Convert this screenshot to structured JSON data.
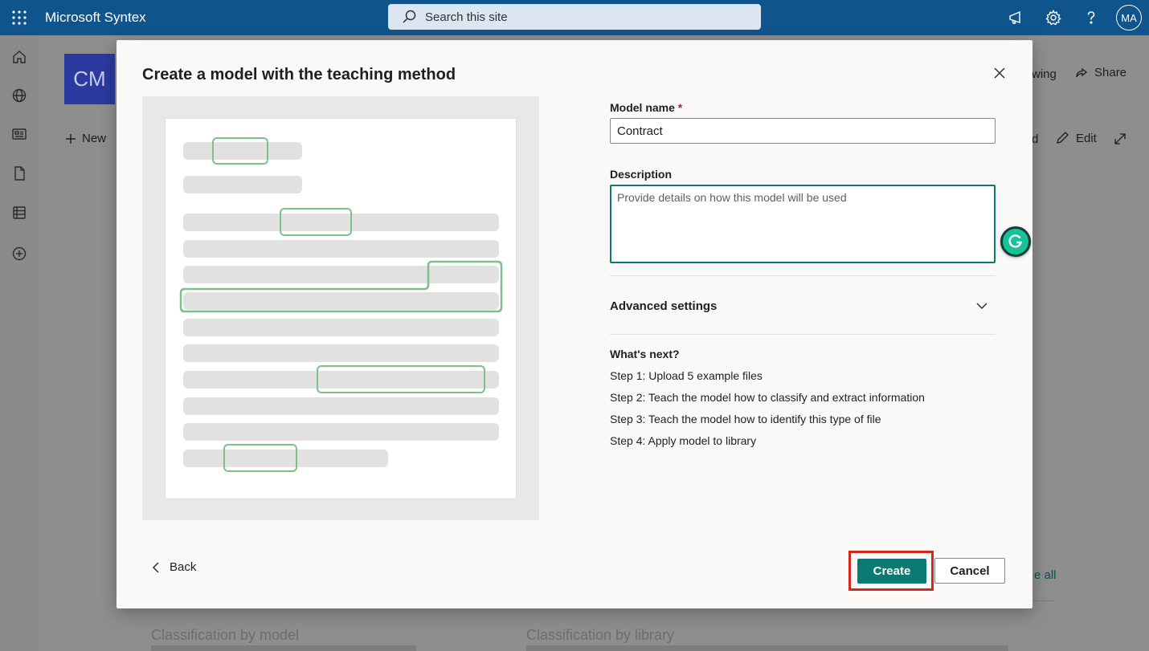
{
  "suitebar": {
    "app_name": "Microsoft Syntex",
    "search_placeholder": "Search this site",
    "avatar_initials": "MA",
    "brand_color": "#0f548c"
  },
  "rail": {
    "icons": [
      "home-icon",
      "globe-icon",
      "news-icon",
      "document-icon",
      "list-icon",
      "add-circle-icon"
    ]
  },
  "background_page": {
    "site_initials": "CM",
    "new_label": "New",
    "following_fragment": "wing",
    "share_label": "Share",
    "d_fragment": "d",
    "edit_label": "Edit",
    "see_all_fragment": "e all",
    "card_titles": [
      "Classification by model",
      "Classification by library"
    ]
  },
  "dialog": {
    "title": "Create a model with the teaching method",
    "model_name_label": "Model name",
    "required_marker": "*",
    "model_name_value": "Contract",
    "description_label": "Description",
    "description_placeholder": "Provide details on how this model will be used",
    "advanced_settings_label": "Advanced settings",
    "whats_next_title": "What's next?",
    "steps": [
      "Step 1: Upload 5 example files",
      "Step 2: Teach the model how to classify and extract information",
      "Step 3: Teach the model how to identify this type of file",
      "Step 4: Apply model to library"
    ],
    "back_label": "Back",
    "create_label": "Create",
    "cancel_label": "Cancel",
    "accent_color": "#0b7a75",
    "highlight_color": "#d5271b"
  }
}
